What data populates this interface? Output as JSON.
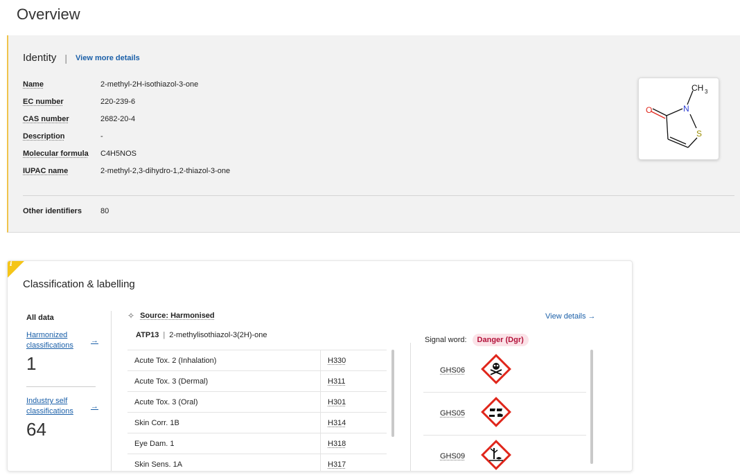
{
  "page": {
    "title": "Overview"
  },
  "identity": {
    "heading": "Identity",
    "separator": "|",
    "more_link": "View more details",
    "fields": [
      {
        "label": "Name",
        "value": "2-methyl-2H-isothiazol-3-one"
      },
      {
        "label": "EC number",
        "value": "220-239-6"
      },
      {
        "label": "CAS number",
        "value": "2682-20-4"
      },
      {
        "label": "Description",
        "value": "-"
      },
      {
        "label": "Molecular formula",
        "value": "C4H5NOS"
      },
      {
        "label": "IUPAC name",
        "value": "2-methyl-2,3-dihydro-1,2-thiazol-3-one"
      }
    ],
    "other_identifiers": {
      "label": "Other identifiers",
      "value": "80"
    },
    "structure_atoms": {
      "o": "O",
      "n": "N",
      "s": "S",
      "ch": "CH",
      "sub": "3"
    }
  },
  "classification": {
    "info_badge": "i",
    "title": "Classification & labelling",
    "all_data": "All data",
    "harmonized": {
      "label_line1": "Harmonized",
      "label_line2": "classifications",
      "arrow": "→",
      "count": "1"
    },
    "industry": {
      "label_line1": "Industry self",
      "label_line2": "classifications",
      "arrow": "→",
      "count": "64"
    },
    "source_label": "Source: Harmonised",
    "source_icon": "sparkle-icon",
    "view_details": "View details →",
    "atp": {
      "code": "ATP13",
      "separator": "|",
      "name": "2-methylisothiazol-3(2H)-one"
    },
    "hazards": [
      {
        "name": "Acute Tox. 2 (Inhalation)",
        "code": "H330"
      },
      {
        "name": "Acute Tox. 3 (Dermal)",
        "code": "H311"
      },
      {
        "name": "Acute Tox. 3 (Oral)",
        "code": "H301"
      },
      {
        "name": "Skin Corr. 1B",
        "code": "H314"
      },
      {
        "name": "Eye Dam. 1",
        "code": "H318"
      },
      {
        "name": "Skin Sens. 1A",
        "code": "H317"
      }
    ],
    "signal_word_label": "Signal word:",
    "signal_word": "Danger (Dgr)",
    "pictograms": [
      {
        "code": "GHS06",
        "icon": "skull-crossbones-icon"
      },
      {
        "code": "GHS05",
        "icon": "corrosion-icon"
      },
      {
        "code": "GHS09",
        "icon": "environment-icon"
      }
    ],
    "colors": {
      "accent": "#1a5fa8",
      "danger": "#b3123a",
      "pictogram_border": "#e0261b",
      "info": "#f5c518"
    }
  }
}
